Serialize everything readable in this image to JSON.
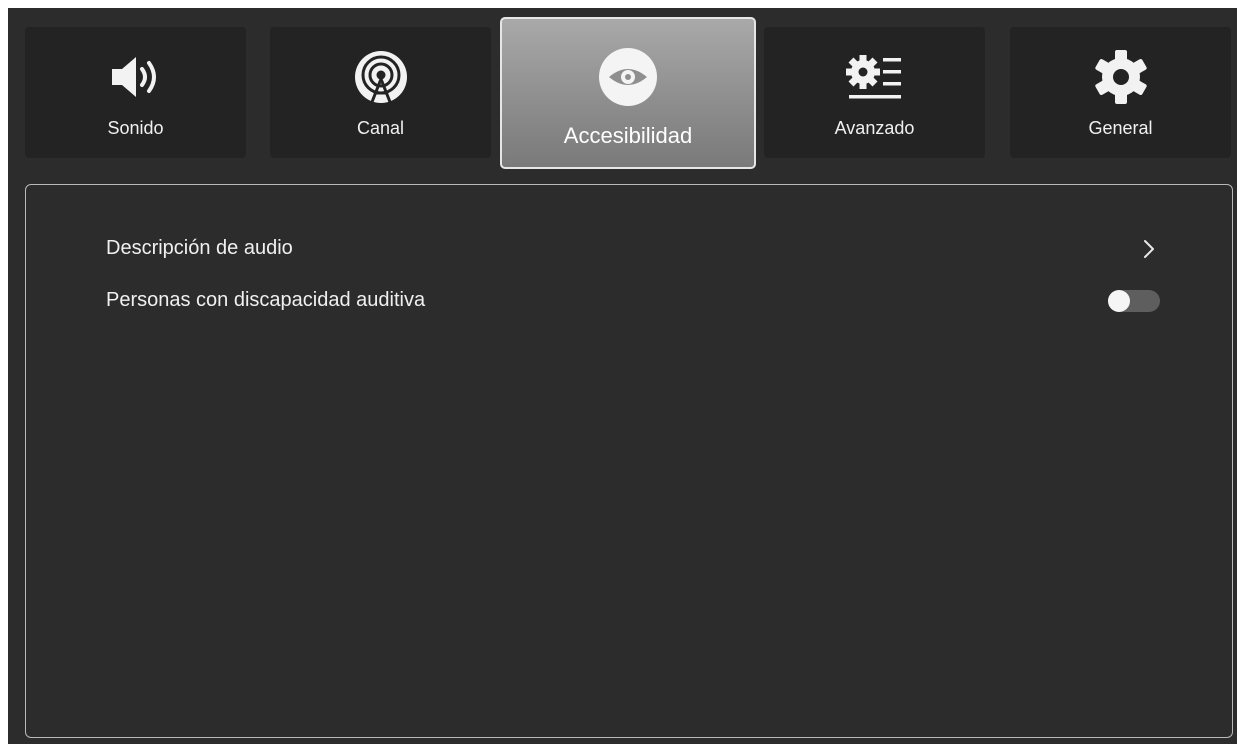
{
  "tabs": [
    {
      "label": "Sonido",
      "icon": "speaker-icon",
      "selected": false
    },
    {
      "label": "Canal",
      "icon": "antenna-icon",
      "selected": false
    },
    {
      "label": "Accesibilidad",
      "icon": "eye-icon",
      "selected": true
    },
    {
      "label": "Avanzado",
      "icon": "gear-list-icon",
      "selected": false
    },
    {
      "label": "General",
      "icon": "gear-icon",
      "selected": false
    }
  ],
  "settings": {
    "items": [
      {
        "label": "Descripción de audio",
        "control": "chevron-right-icon"
      },
      {
        "label": "Personas con discapacidad auditiva",
        "control": "toggle",
        "value": false
      }
    ]
  },
  "colors": {
    "background": "#2c2c2c",
    "tab_background": "#232323",
    "active_tab": "#959595",
    "text": "#f0f0f0",
    "toggle_track": "#5e5e5e",
    "toggle_knob": "#f5f5f5"
  }
}
